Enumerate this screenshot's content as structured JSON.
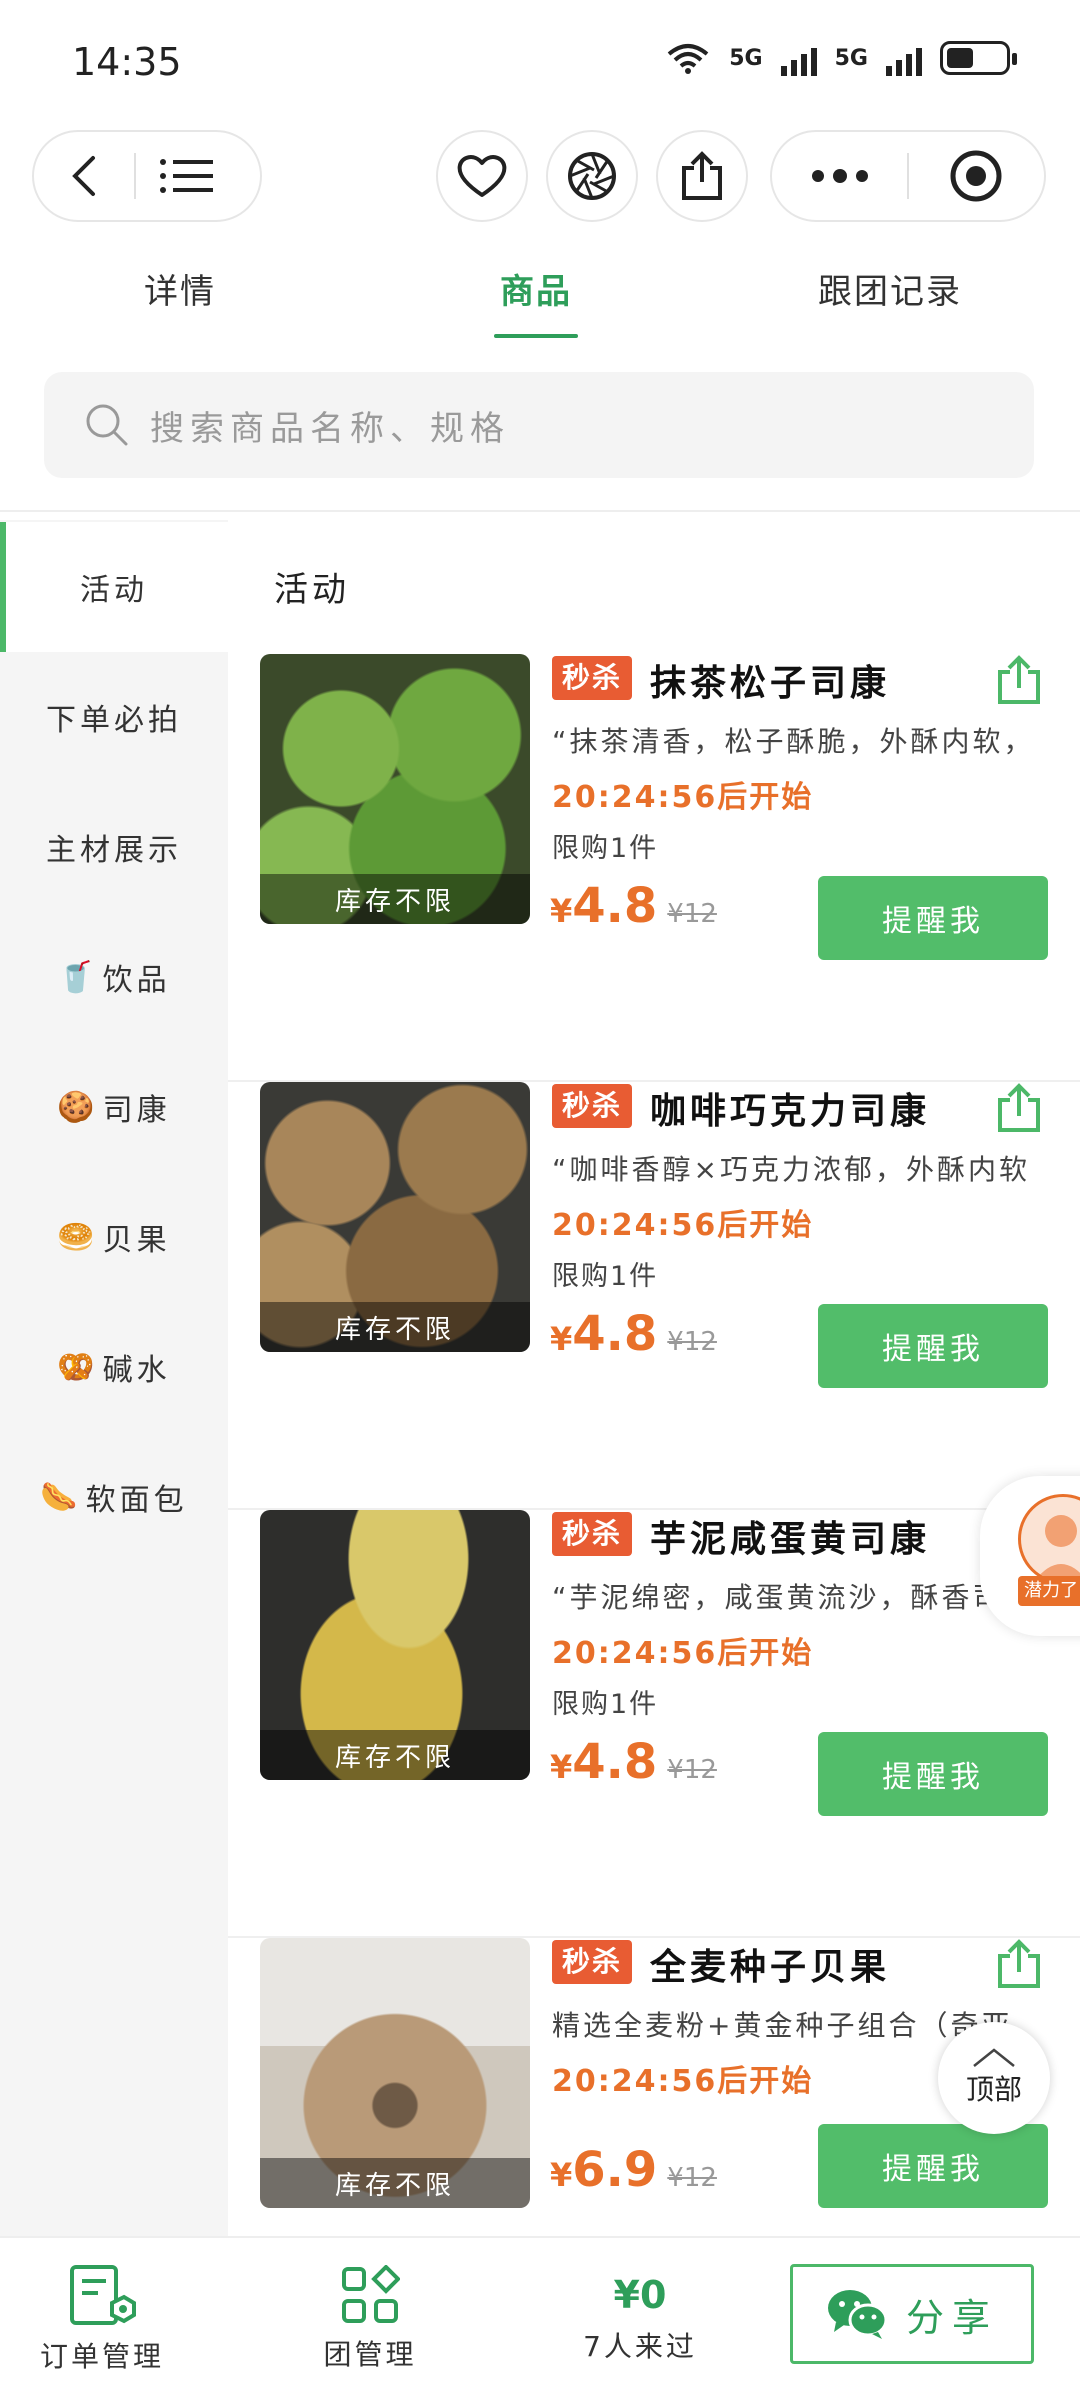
{
  "status_bar": {
    "time": "14:35",
    "net1": "5G",
    "net2": "5G",
    "wifi_tag": "6"
  },
  "tabs": [
    {
      "label": "详情"
    },
    {
      "label": "商品",
      "active": true
    },
    {
      "label": "跟团记录"
    }
  ],
  "search": {
    "placeholder": "搜索商品名称、规格"
  },
  "sidebar": {
    "items": [
      {
        "label": "活动",
        "emoji": ""
      },
      {
        "label": "下单必拍",
        "emoji": ""
      },
      {
        "label": "主材展示",
        "emoji": ""
      },
      {
        "label": "饮品",
        "emoji": "🥤"
      },
      {
        "label": "司康",
        "emoji": "🍪"
      },
      {
        "label": "贝果",
        "emoji": "🥯"
      },
      {
        "label": "碱水",
        "emoji": "🥨"
      },
      {
        "label": "软面包",
        "emoji": "🌭"
      }
    ]
  },
  "section_title": "活动",
  "products": [
    {
      "tag": "秒杀",
      "name": "抹茶松子司康",
      "desc": "“抹茶清香，松子酥脆，外酥内软，",
      "countdown": "20:24:56后开始",
      "limit": "限购1件",
      "currency": "¥",
      "price": "4.8",
      "old_price": "¥12",
      "stock": "库存不限",
      "button": "提醒我"
    },
    {
      "tag": "秒杀",
      "name": "咖啡巧克力司康",
      "desc": "“咖啡香醇×巧克力浓郁，外酥内软",
      "countdown": "20:24:56后开始",
      "limit": "限购1件",
      "currency": "¥",
      "price": "4.8",
      "old_price": "¥12",
      "stock": "库存不限",
      "button": "提醒我"
    },
    {
      "tag": "秒杀",
      "name": "芋泥咸蛋黄司康",
      "desc": "“芋泥绵密，咸蛋黄流沙，酥香司康",
      "countdown": "20:24:56后开始",
      "limit": "限购1件",
      "currency": "¥",
      "price": "4.8",
      "old_price": "¥12",
      "stock": "库存不限",
      "button": "提醒我"
    },
    {
      "tag": "秒杀",
      "name": "全麦种子贝果",
      "desc": "精选全麦粉+黄金种子组合（奇亚",
      "countdown": "20:24:56后开始",
      "limit": "",
      "currency": "¥",
      "price": "6.9",
      "old_price": "¥12",
      "stock": "库存不限",
      "button": "提醒我"
    }
  ],
  "floating": {
    "avatar_label": "潜力了",
    "top_label": "顶部"
  },
  "bottom_bar": {
    "order_mgmt": "订单管理",
    "group_mgmt": "团管理",
    "amount": "¥0",
    "visitors": "7人来过",
    "share": "分享"
  },
  "colors": {
    "brand_green": "#2e9e5a",
    "button_green": "#52bd6a",
    "price_orange": "#e8702a",
    "tag_red": "#e85c33"
  }
}
